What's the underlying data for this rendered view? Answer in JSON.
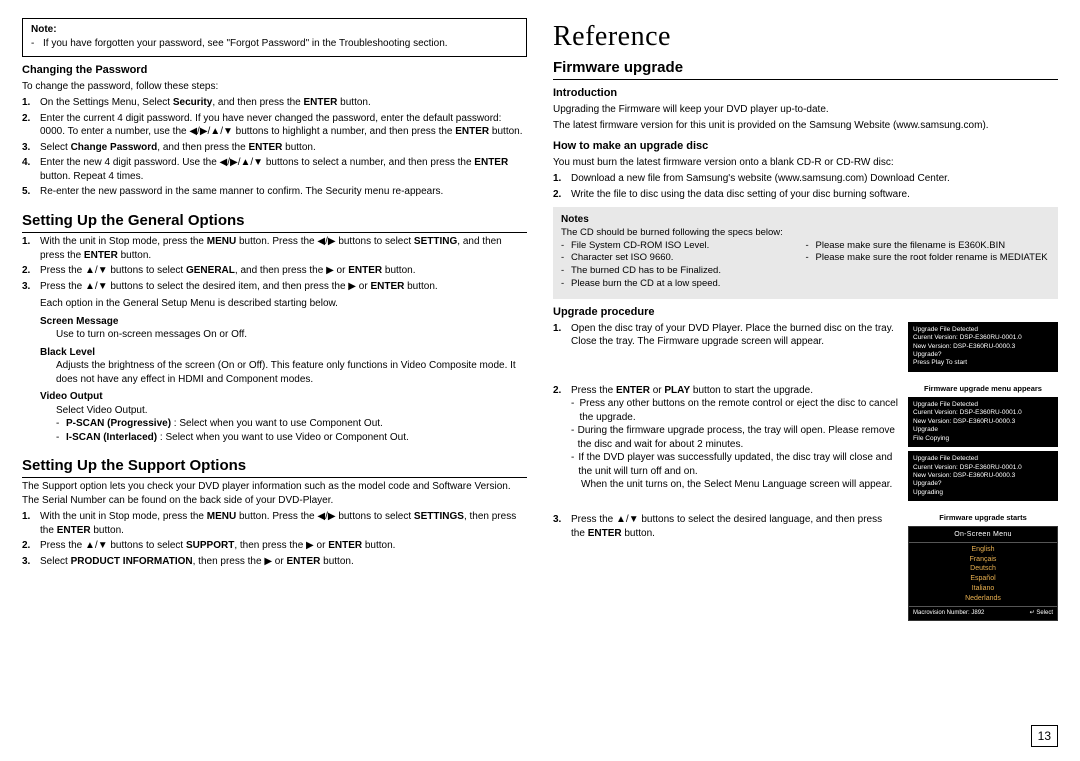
{
  "left": {
    "noteTitle": "Note:",
    "noteText": "If you have forgotten your password, see \"Forgot Password\" in the Troubleshooting section.",
    "changePwdHeading": "Changing the Password",
    "changePwdIntro": "To change the password, follow these steps:",
    "pwSteps": {
      "s1a": "On the Settings Menu, Select ",
      "s1b": "Security",
      "s1c": ", and then press the ",
      "s1d": "ENTER",
      "s1e": " button.",
      "s2a": "Enter the current 4 digit password. If you have never changed the password, enter the default password: 0000. To enter a number, use the ◀/▶/▲/▼ buttons to highlight a number, and then press the ",
      "s2b": "ENTER",
      "s2c": " button.",
      "s3a": "Select ",
      "s3b": "Change Password",
      "s3c": ", and then press the ",
      "s3d": "ENTER",
      "s3e": " button.",
      "s4a": "Enter the new 4 digit password. Use the ◀/▶/▲/▼ buttons to select a number, and then press the ",
      "s4b": "ENTER",
      "s4c": " button. Repeat 4 times.",
      "s5": "Re-enter the new password in the same manner to confirm. The Security menu re-appears."
    },
    "genHeading": "Setting Up the General Options",
    "genSteps": {
      "g1a": "With the unit in Stop mode, press the ",
      "g1b": "MENU",
      "g1c": " button. Press the ◀/▶ buttons to select ",
      "g1d": "SETTING",
      "g1e": ", and then press the ",
      "g1f": "ENTER",
      "g1g": " button.",
      "g2a": "Press the ▲/▼ buttons to select ",
      "g2b": "GENERAL",
      "g2c": ", and then press the ▶ or ",
      "g2d": "ENTER",
      "g2e": " button.",
      "g3a": "Press the ▲/▼ buttons to select the desired item, and then press the ▶ or ",
      "g3b": "ENTER",
      "g3c": " button."
    },
    "genDescIntro": "Each option in the General Setup Menu is described starting below.",
    "optScreenMsgName": "Screen Message",
    "optScreenMsgDesc": "Use to turn on-screen messages On or Off.",
    "optBlackName": "Black Level",
    "optBlackDesc": "Adjusts the brightness of the screen (On or Off). This feature only functions in Video Composite mode. It does not have any effect in HDMI and Component modes.",
    "optVideoName": "Video Output",
    "optVideoDesc": "Select Video Output.",
    "optPscanA": "P-SCAN (Progressive)",
    "optPscanB": " : Select when you want to use Component Out.",
    "optIscanA": "I-SCAN (Interlaced)",
    "optIscanB": " : Select when you want to use Video or Component Out.",
    "supHeading": "Setting Up the Support Options",
    "supIntro": "The Support option lets you check your DVD player information such as the model code and Software Version. The Serial Number can be found on the back side of your DVD-Player.",
    "supSteps": {
      "s1a": "With the unit in Stop mode, press the ",
      "s1b": "MENU",
      "s1c": " button. Press the ◀/▶ buttons to select ",
      "s1d": "SETTINGS",
      "s1e": ", then press the ",
      "s1f": "ENTER",
      "s1g": " button.",
      "s2a": "Press the ▲/▼ buttons to select ",
      "s2b": "SUPPORT",
      "s2c": ", then press the ▶ or ",
      "s2d": "ENTER",
      "s2e": " button.",
      "s3a": "Select ",
      "s3b": "PRODUCT INFORMATION",
      "s3c": ", then press the ▶ or ",
      "s3d": "ENTER",
      "s3e": " button."
    }
  },
  "right": {
    "refHeading": "Reference",
    "fwHeading": "Firmware upgrade",
    "introHeading": "Introduction",
    "intro1": "Upgrading the Firmware will keep your DVD player up-to-date.",
    "intro2": "The latest firmware version for this unit is provided on the Samsung Website (www.samsung.com).",
    "howHeading": "How to make an upgrade disc",
    "howIntro": "You must burn the latest firmware version onto a blank CD-R or CD-RW disc:",
    "howSteps": {
      "h1": "Download a new file from Samsung's website (www.samsung.com) Download Center.",
      "h2": "Write the file to disc using the data disc setting of your disc burning software."
    },
    "notesHeading": "Notes",
    "notesIntro": "The CD should be burned following the specs below:",
    "notesL1": "File System CD-ROM ISO Level.",
    "notesL2": "Character set ISO 9660.",
    "notesL3": "The burned CD has to be Finalized.",
    "notesL4": "Please burn the CD at a low speed.",
    "notesR1": "Please make sure the filename is E360K.BIN",
    "notesR2": "Please make sure the root folder rename is MEDIATEK",
    "upHeading": "Upgrade procedure",
    "up1": "Open the disc tray of your DVD Player. Place the burned disc on the tray. Close the tray. The Firmware upgrade screen will appear.",
    "up2a": "Press the ",
    "up2b": "ENTER",
    "up2c": " or ",
    "up2d": "PLAY",
    "up2e": " button to start the upgrade.",
    "up2bul1": "Press any other buttons on the remote control or eject the disc to cancel the upgrade.",
    "up2bul2": "During the firmware upgrade process, the tray will open. Please remove the disc and wait for about 2 minutes.",
    "up2bul3": "If the DVD player was successfully updated, the disc tray will close and the unit will turn off and on.",
    "up2tail": "When the unit turns on, the Select Menu Language screen will appear.",
    "up3a": "Press the ▲/▼ buttons to select the desired language, and then press the ",
    "up3b": "ENTER",
    "up3c": " button.",
    "fwBox1": {
      "l1": "Upgrade File Detected",
      "l2": "Curent Version: DSP-E360RU-0001.0",
      "l3": "New Version: DSP-E360RU-0000.3",
      "l4": "Upgrade?",
      "l5": "Press Play To start"
    },
    "cap1": "Firmware upgrade menu appears",
    "fwBox2": {
      "l1": "Upgrade File Detected",
      "l2": "Curent Version: DSP-E360RU-0001.0",
      "l3": "New Version: DSP-E360RU-0000.3",
      "l4": "Upgrade",
      "l5": "File Copying"
    },
    "fwBox3": {
      "l1": "Upgrade File Detected",
      "l2": "Curent Version: DSP-E360RU-0001.0",
      "l3": "New Version: DSP-E360RU-0000.3",
      "l4": "Upgrade?",
      "l5": "Upgrading"
    },
    "cap2": "Firmware upgrade starts",
    "langTitle": "On-Screen Menu",
    "langs": [
      "English",
      "Français",
      "Deutsch",
      "Español",
      "Italiano",
      "Nederlands"
    ],
    "langFooterL": "Macrovision Number: J892",
    "langFooterR": "↵ Select"
  },
  "pageNum": "13"
}
